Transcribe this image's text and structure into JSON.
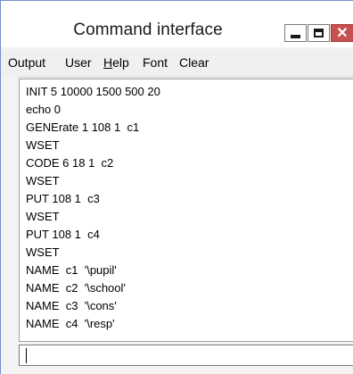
{
  "window": {
    "title": "Command interface",
    "close_glyph": "✕",
    "close_color": "#c75050",
    "border_color": "#6f93c8"
  },
  "menu": {
    "items": [
      {
        "label": "Output",
        "mnemonic": ""
      },
      {
        "label": "User",
        "mnemonic": ""
      },
      {
        "label": "Help",
        "mnemonic": "H"
      },
      {
        "label": "Font",
        "mnemonic": ""
      },
      {
        "label": "Clear",
        "mnemonic": ""
      }
    ]
  },
  "output": {
    "lines": [
      "INIT 5 10000 1500 500 20",
      "echo 0",
      "GENErate 1 108 1  c1",
      "WSET",
      "CODE 6 18 1  c2",
      "WSET",
      "PUT 108 1  c3",
      "WSET",
      "PUT 108 1  c4",
      "WSET",
      "NAME  c1  '\\pupil'",
      "NAME  c2  '\\school'",
      "NAME  c3  '\\cons'",
      "NAME  c4  '\\resp'"
    ]
  },
  "input": {
    "value": ""
  },
  "icons": {
    "minimize": "minimize-icon",
    "maximize": "maximize-icon",
    "close": "close-icon"
  }
}
